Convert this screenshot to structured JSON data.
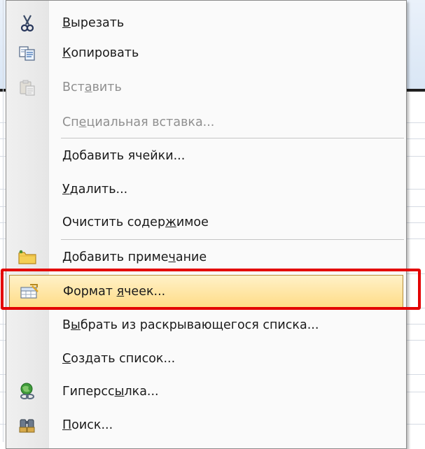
{
  "menu": {
    "items": [
      {
        "id": "cut",
        "pre": "",
        "mn": "В",
        "post": "ырезать",
        "disabled": false,
        "icon": "scissors-icon"
      },
      {
        "id": "copy",
        "pre": "",
        "mn": "К",
        "post": "опировать",
        "disabled": false,
        "icon": "copy-icon"
      },
      {
        "id": "paste",
        "pre": "Вст",
        "mn": "а",
        "post": "вить",
        "disabled": true,
        "icon": "paste-icon"
      },
      {
        "id": "paste-special",
        "pre": "Сп",
        "mn": "е",
        "post": "циальная вставка...",
        "disabled": true,
        "icon": ""
      },
      {
        "id": "insert-cells",
        "pre": "",
        "mn": "Д",
        "post": "обавить ячейки...",
        "disabled": false,
        "icon": ""
      },
      {
        "id": "delete",
        "pre": "",
        "mn": "У",
        "post": "далить...",
        "disabled": false,
        "icon": ""
      },
      {
        "id": "clear-contents",
        "pre": "Очистить содер",
        "mn": "ж",
        "post": "имое",
        "disabled": false,
        "icon": ""
      },
      {
        "id": "insert-comment",
        "pre": "Добавить приме",
        "mn": "ч",
        "post": "ание",
        "disabled": false,
        "icon": "comment-icon"
      },
      {
        "id": "format-cells",
        "pre": "Формат ",
        "mn": "я",
        "post": "чеек...",
        "disabled": false,
        "icon": "format-cells-icon",
        "highlighted": true
      },
      {
        "id": "pick-from-list",
        "pre": "В",
        "mn": "ы",
        "post": "брать из раскрывающегося списка...",
        "disabled": false,
        "icon": ""
      },
      {
        "id": "create-list",
        "pre": "",
        "mn": "С",
        "post": "оздать список...",
        "disabled": false,
        "icon": ""
      },
      {
        "id": "hyperlink",
        "pre": "Гиперсс",
        "mn": "ы",
        "post": "лка...",
        "disabled": false,
        "icon": "hyperlink-icon"
      },
      {
        "id": "search",
        "pre": "",
        "mn": "П",
        "post": "оиск...",
        "disabled": false,
        "icon": "search-icon"
      }
    ]
  },
  "colors": {
    "highlight_border": "#e30000",
    "hover_fill": "#ffdc86",
    "disabled_text": "#8f8f8f"
  }
}
